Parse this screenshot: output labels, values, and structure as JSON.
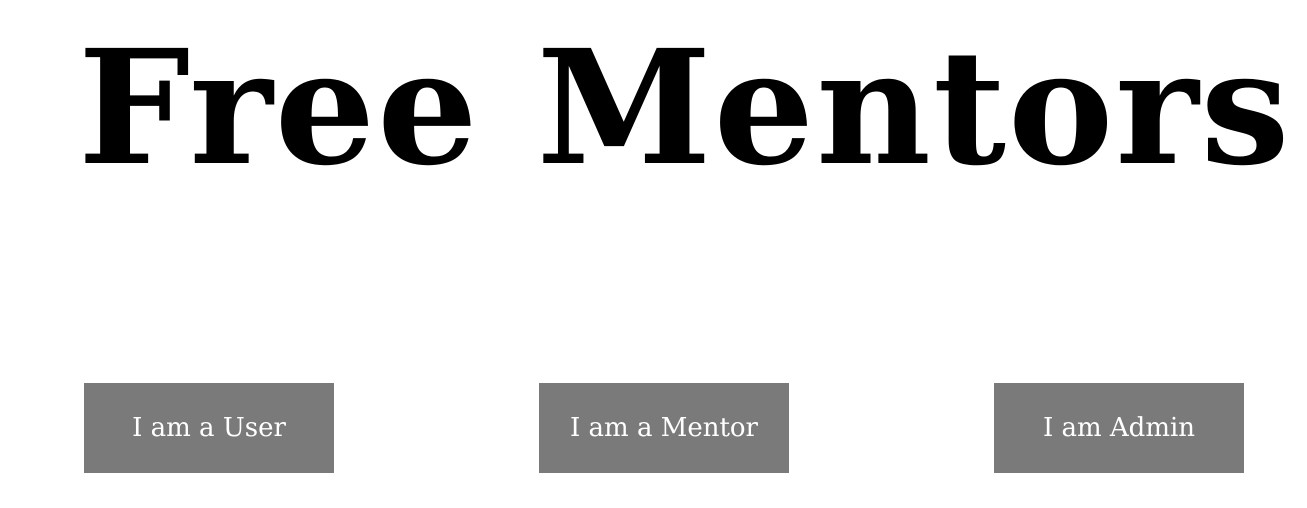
{
  "header": {
    "title": "Free Mentors"
  },
  "roles": {
    "user_label": "I am a User",
    "mentor_label": "I am a Mentor",
    "admin_label": "I am Admin"
  },
  "colors": {
    "button_background": "#7a7a7a",
    "button_text": "#ffffff",
    "title_text": "#000000",
    "page_background": "#ffffff"
  }
}
